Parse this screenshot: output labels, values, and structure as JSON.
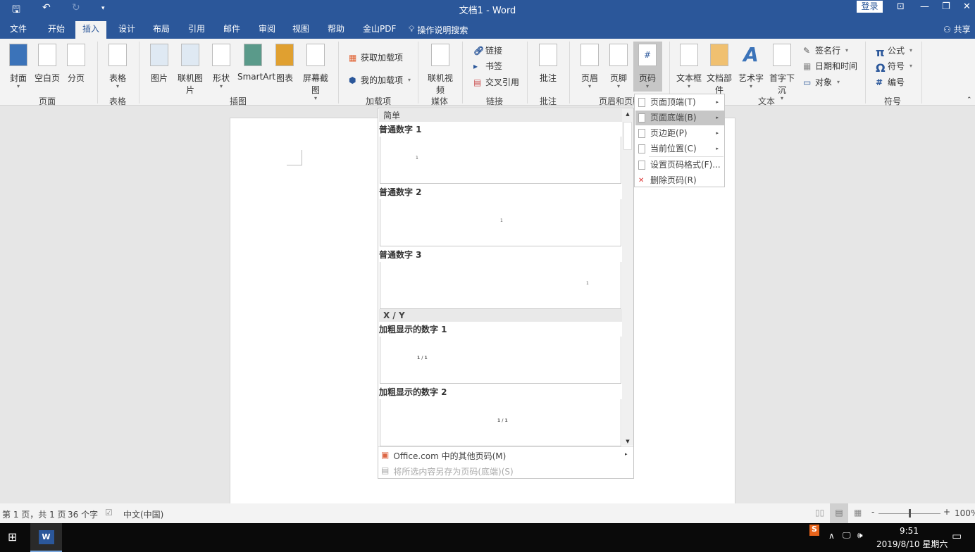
{
  "window": {
    "title": "文档1 - Word",
    "login": "登录",
    "share": "共享"
  },
  "tabs": [
    "文件",
    "开始",
    "插入",
    "设计",
    "布局",
    "引用",
    "邮件",
    "审阅",
    "视图",
    "帮助",
    "金山PDF"
  ],
  "active_tab": "插入",
  "search": "操作说明搜索",
  "ribbon": {
    "big_buttons": [
      "封面",
      "空白页",
      "分页",
      "表格",
      "图片",
      "联机图片",
      "形状",
      "SmartArt",
      "图表",
      "屏幕截图",
      "联机视频",
      "批注",
      "页眉",
      "页脚",
      "页码",
      "文本框",
      "文档部件",
      "艺术字",
      "首字下沉"
    ],
    "small_buttons": [
      "获取加载项",
      "我的加载项",
      "链接",
      "书签",
      "交叉引用",
      "签名行",
      "日期和时间",
      "对象",
      "公式",
      "符号",
      "编号"
    ],
    "groups": [
      "页面",
      "表格",
      "插图",
      "加载项",
      "媒体",
      "链接",
      "批注",
      "页眉和页脚",
      "文本",
      "符号"
    ]
  },
  "gallery": {
    "sections": [
      "简单",
      "X / Y"
    ],
    "items": [
      {
        "title": "普通数字 1",
        "preview": "1"
      },
      {
        "title": "普通数字 2",
        "preview": "1"
      },
      {
        "title": "普通数字 3",
        "preview": "1"
      },
      {
        "title": "加粗显示的数字 1",
        "preview": "1 / 1"
      },
      {
        "title": "加粗显示的数字 2",
        "preview": "1 / 1"
      }
    ],
    "more": "Office.com 中的其他页码(M)",
    "save": "将所选内容另存为页码(底端)(S)"
  },
  "submenu": {
    "items": [
      "页面顶端(T)",
      "页面底端(B)",
      "页边距(P)",
      "当前位置(C)",
      "设置页码格式(F)...",
      "删除页码(R)"
    ],
    "highlighted": "页面底端(B)"
  },
  "status": {
    "page": "第 1 页，共 1 页",
    "words": "36 个字",
    "lang": "中文(中国)",
    "zoom": "100%",
    "zoom_level": 100
  },
  "taskbar": {
    "time": "9:51",
    "date": "2019/8/10 星期六"
  },
  "colors": {
    "brand": "#2b579a",
    "ribbon": "#f3f3f3",
    "highlight": "#c6c6c6"
  }
}
